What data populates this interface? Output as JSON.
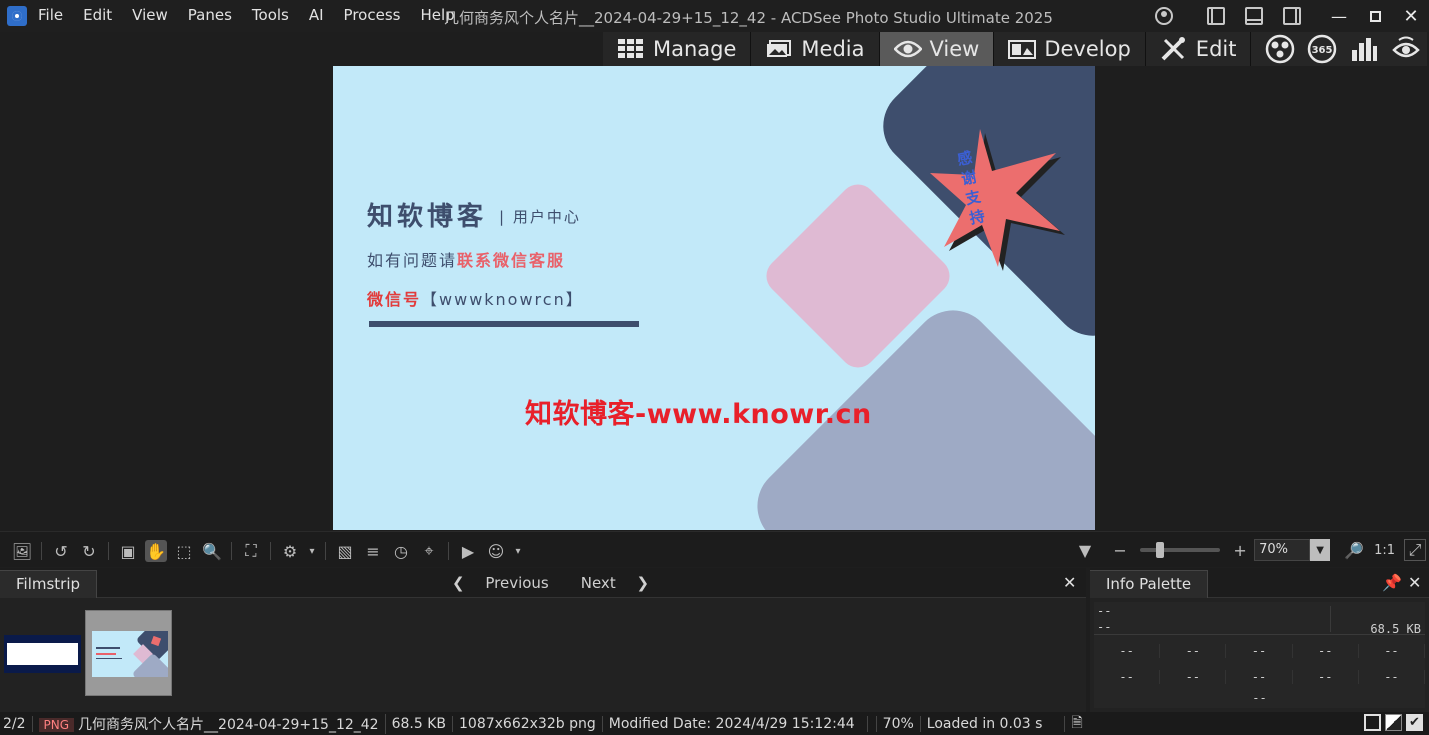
{
  "menu": [
    "File",
    "Edit",
    "View",
    "Panes",
    "Tools",
    "AI",
    "Process",
    "Help"
  ],
  "window_title": "几何商务风个人名片__2024-04-29+15_12_42 - ACDSee Photo Studio Ultimate 2025",
  "modes": [
    {
      "label": "Manage",
      "icon": "grid-icon"
    },
    {
      "label": "Media",
      "icon": "media-icon"
    },
    {
      "label": "View",
      "icon": "eye-icon",
      "active": true
    },
    {
      "label": "Develop",
      "icon": "develop-icon"
    },
    {
      "label": "Edit",
      "icon": "edit-icon"
    }
  ],
  "mode_extra": [
    "people-icon",
    "365-icon",
    "dashboard-icon",
    "eye-refresh-icon"
  ],
  "mode_365_label": "365",
  "card": {
    "title": "知软博客",
    "subtitle": "| 用户中心",
    "line1_prefix": "如有问题请",
    "line1_highlight": "联系微信客服",
    "line2_label": "微信号",
    "line2_value": "【wwwknowrcn】",
    "burst_text": "感谢支持",
    "watermark": "知软博客-www.knowr.cn"
  },
  "zoom": {
    "value": "70%",
    "ratio_label": "1:1"
  },
  "filmstrip": {
    "tab": "Filmstrip",
    "previous": "Previous",
    "next": "Next"
  },
  "info_palette": {
    "tab": "Info Palette",
    "line1": "--",
    "line2": "--",
    "filesize": "68.5 KB",
    "cell": "--"
  },
  "status": {
    "index": "2/2",
    "format": "PNG",
    "filename": "几何商务风个人名片__2024-04-29+15_12_42",
    "size": "68.5 KB",
    "dimensions": "1087x662x32b png",
    "modified": "Modified Date: 2024/4/29 15:12:44",
    "zoom": "70%",
    "loaded": "Loaded in 0.03 s"
  },
  "colors": {
    "card_bg": "#c2e9f9",
    "card_dark": "#3e4e6d",
    "accent_red": "#e8202a",
    "burst": "#ec6e6e"
  }
}
